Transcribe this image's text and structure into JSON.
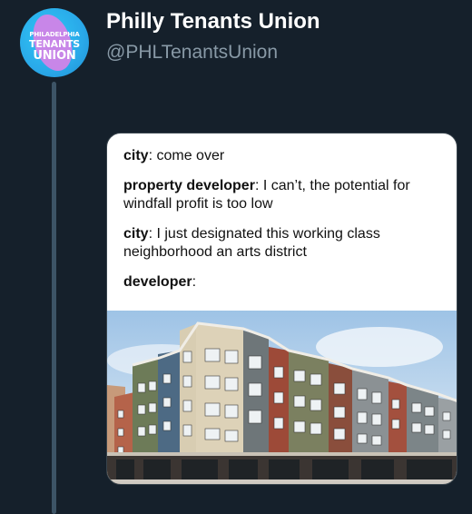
{
  "author": {
    "display_name": "Philly Tenants Union",
    "handle": "@PHLTenantsUnion",
    "avatar_text": [
      "PHILADELPHIA",
      "TENANTS",
      "UNION"
    ]
  },
  "meme": {
    "lines": [
      {
        "speaker": "city",
        "text": ": come over"
      },
      {
        "speaker": "property developer",
        "text": ": I can’t, the potential for windfall profit is too low"
      },
      {
        "speaker": "city",
        "text": ": I just designated this working class neighborhood an arts district"
      },
      {
        "speaker": "developer",
        "text": ":"
      }
    ],
    "image_subject": "apartment-building-photo"
  },
  "colors": {
    "background": "#15202b",
    "thread_line": "#3d5466",
    "name": "#ffffff",
    "handle": "#8899a6",
    "avatar_bg": "#2aa9e9",
    "avatar_blob": "#c886e8"
  }
}
